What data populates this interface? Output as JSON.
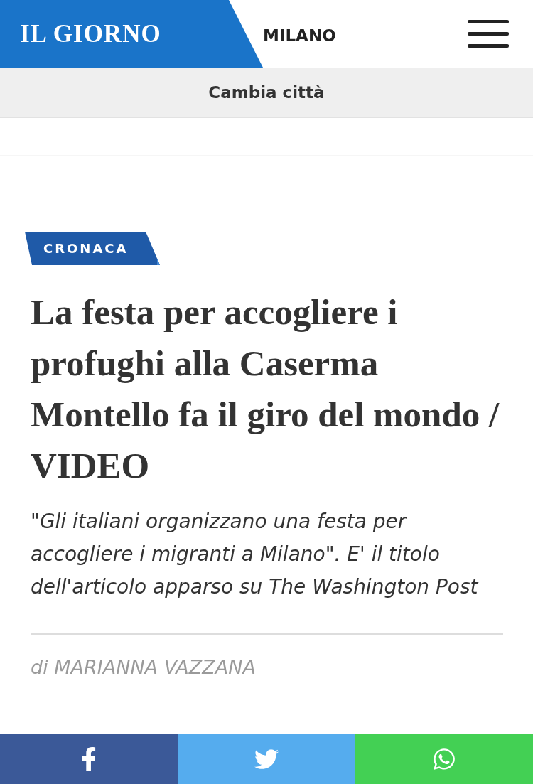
{
  "header": {
    "logo": "IL GIORNO",
    "city": "MILANO"
  },
  "city_bar": {
    "label": "Cambia città"
  },
  "article": {
    "category": "CRONACA",
    "title": "La festa per accogliere i profughi alla Caserma Montello fa il giro del mondo / VIDEO",
    "subtitle": "\"Gli italiani organizzano una festa per accogliere i migranti a Milano\". E' il titolo dell'articolo apparso su The Washington Post",
    "byline": "di MARIANNA VAZZANA"
  },
  "share_buttons": [
    {
      "kind": "facebook",
      "color": "#3b5998"
    },
    {
      "kind": "twitter",
      "color": "#55acee"
    },
    {
      "kind": "whatsapp",
      "color": "#43d054"
    }
  ]
}
